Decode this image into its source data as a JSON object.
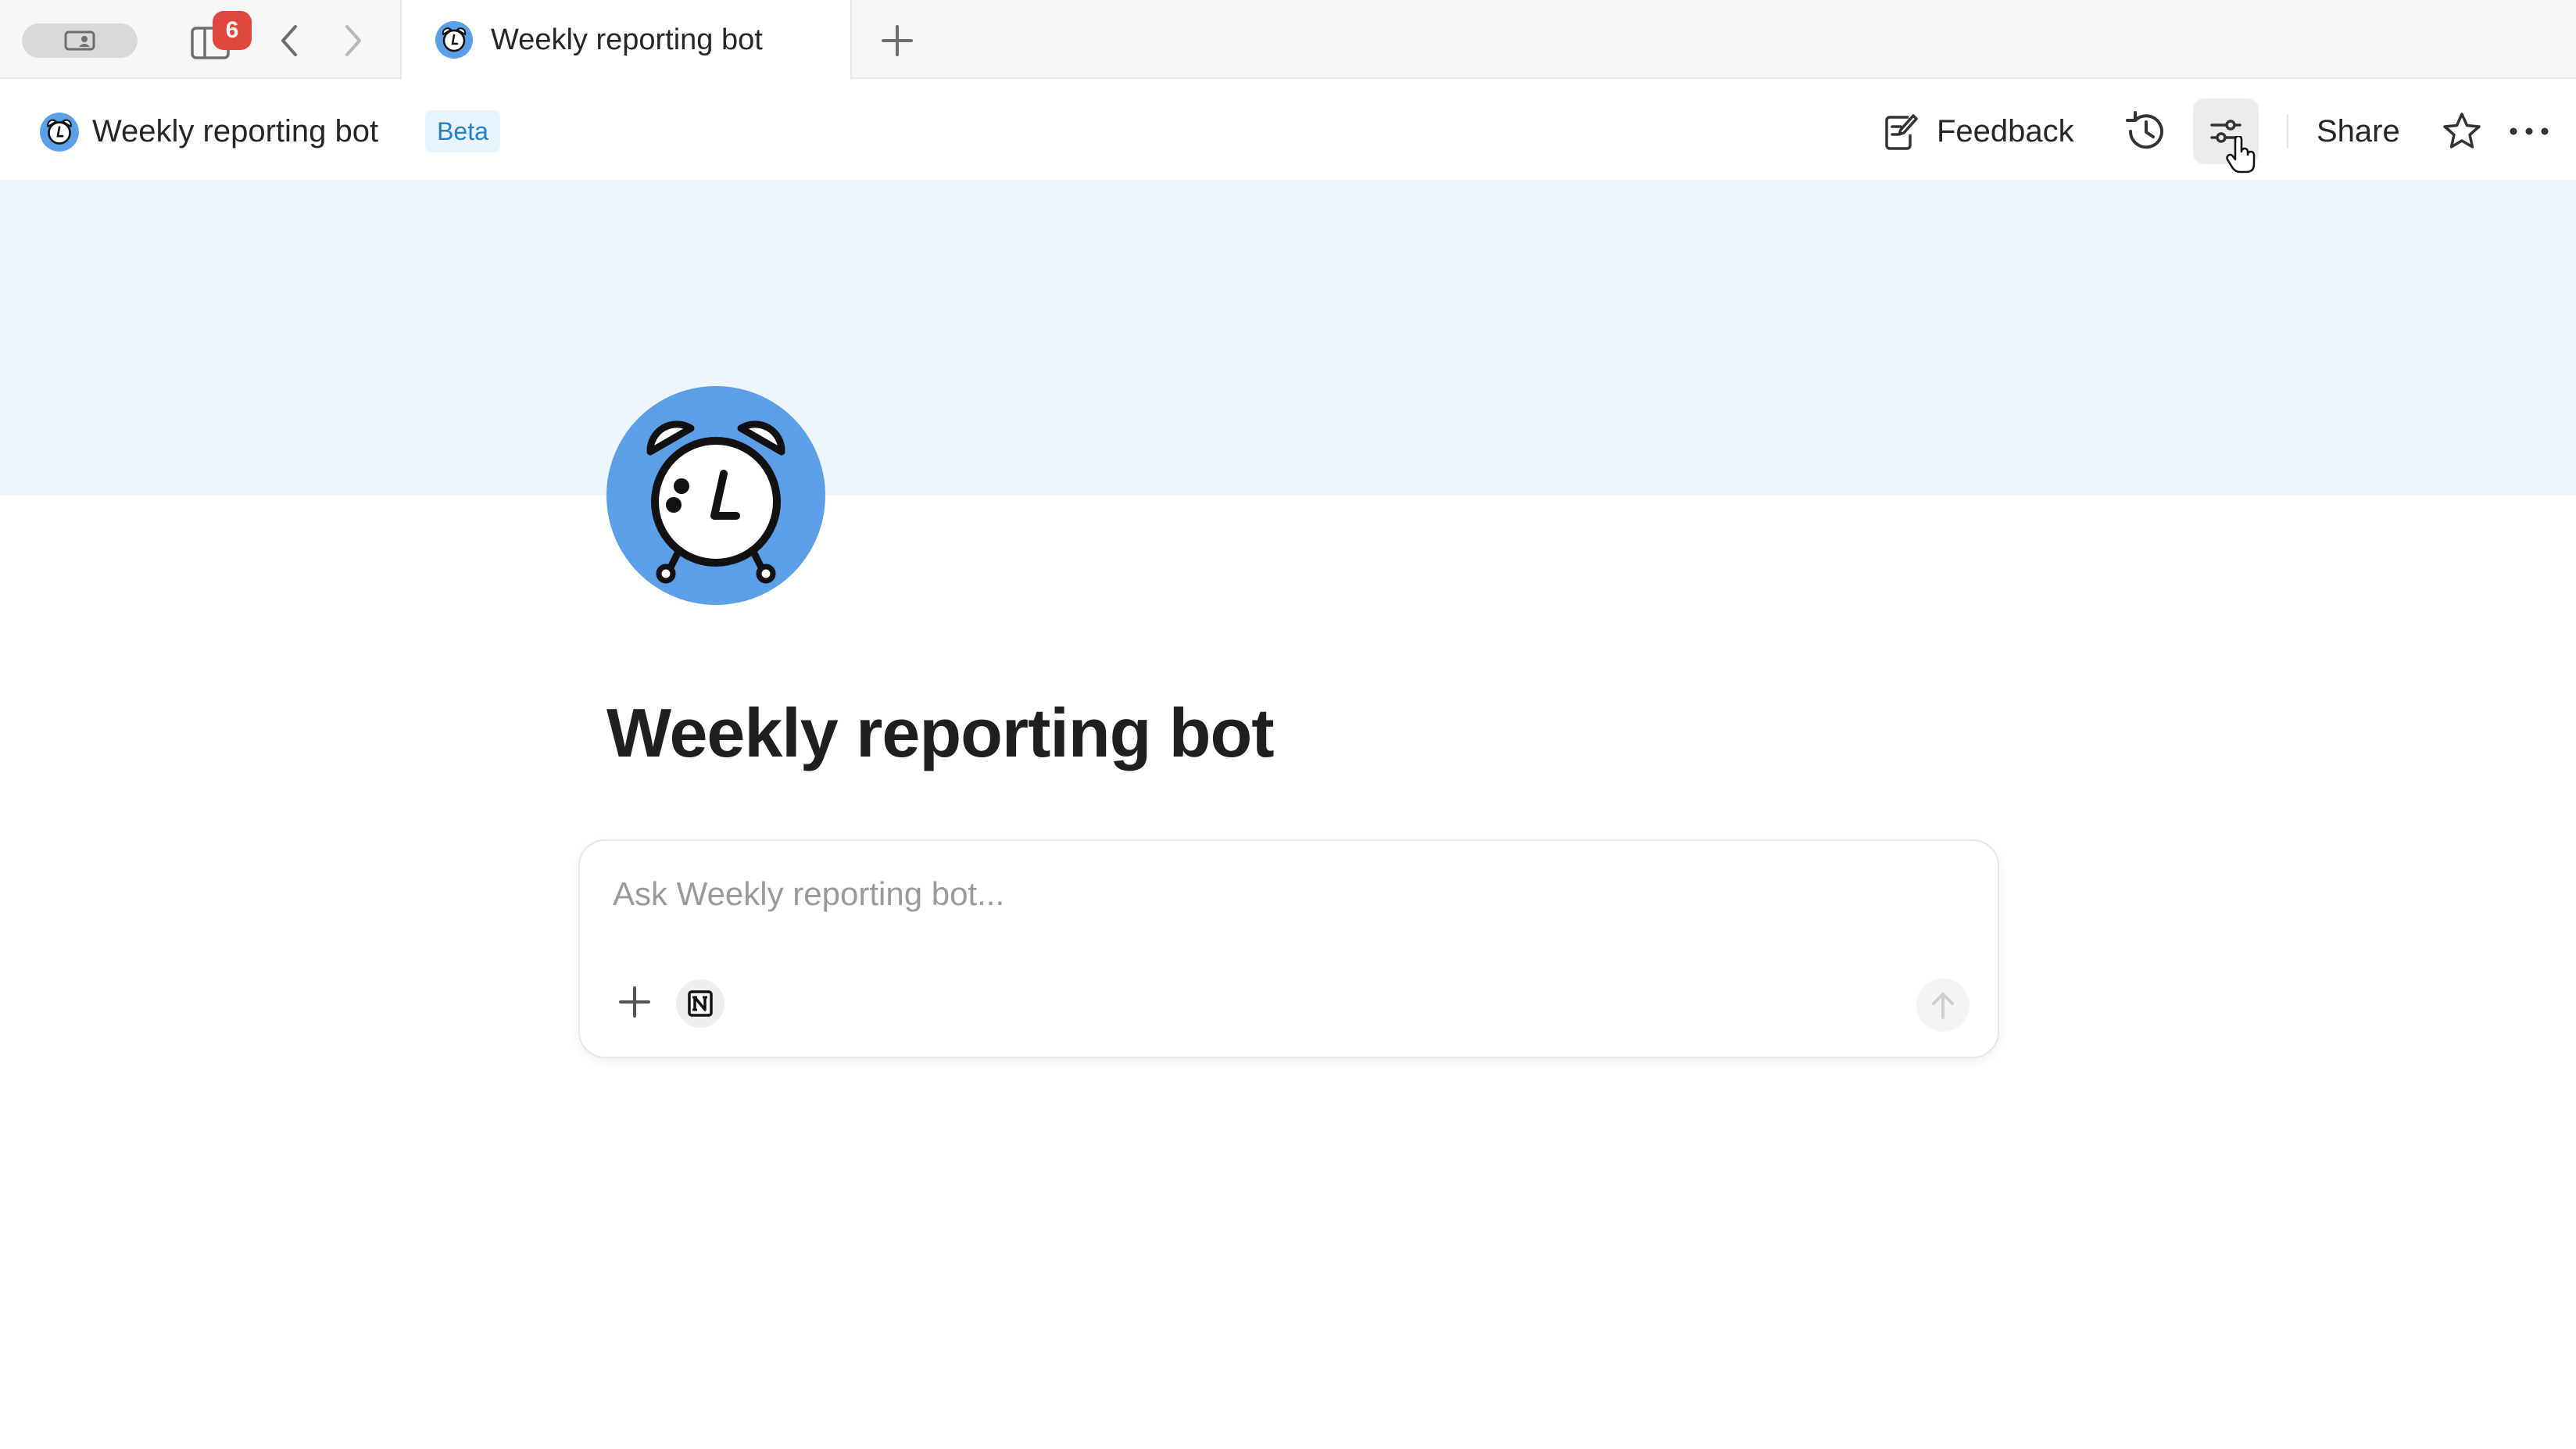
{
  "browser": {
    "tab_count_badge": "6",
    "active_tab_title": "Weekly reporting bot"
  },
  "header": {
    "title": "Weekly reporting bot",
    "badge": "Beta",
    "feedback_label": "Feedback",
    "share_label": "Share"
  },
  "page": {
    "title": "Weekly reporting bot",
    "icon": "alarm-clock-icon",
    "icon_bg": "#5b9fe6",
    "cover_color": "#eef5fd"
  },
  "chat": {
    "placeholder": "Ask Weekly reporting bot...",
    "value": ""
  },
  "icons": {
    "profile": "profile-card-icon",
    "sidebar": "sidebar-icon",
    "back": "chevron-left-icon",
    "forward": "chevron-right-icon",
    "new_tab": "plus-icon",
    "feedback": "feedback-edit-icon",
    "history": "history-clock-icon",
    "customize": "sliders-icon",
    "star": "star-icon",
    "more": "more-dots-icon",
    "attach": "plus-icon",
    "notion": "notion-logo-icon",
    "send": "arrow-up-icon"
  },
  "colors": {
    "accent": "#1f7fc7",
    "badge_red": "#e0473f"
  }
}
